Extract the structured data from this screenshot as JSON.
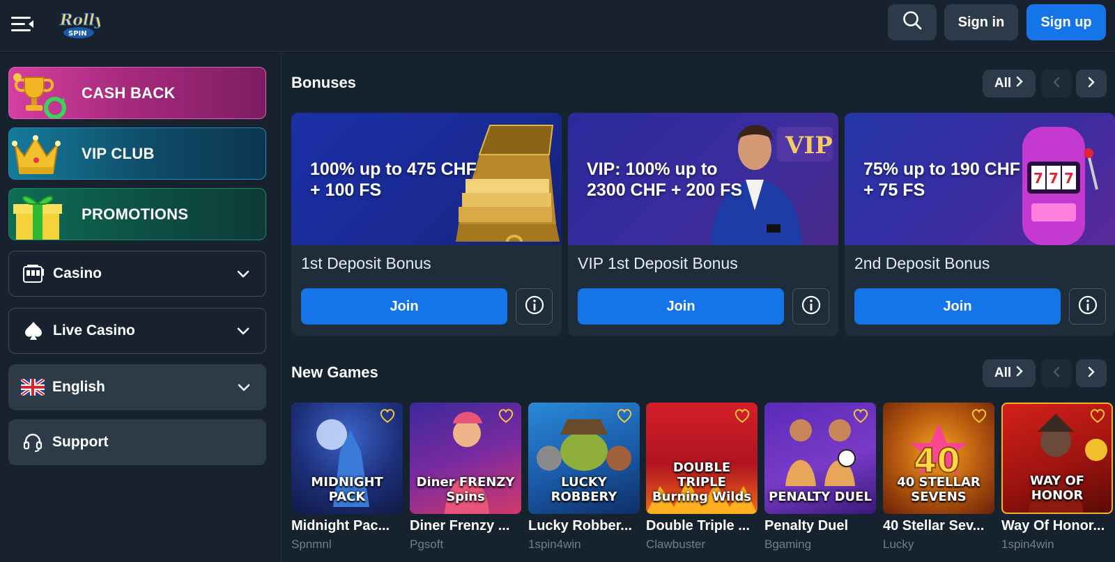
{
  "header": {
    "search_label": "",
    "signin_label": "Sign in",
    "signup_label": "Sign up"
  },
  "sidebar": {
    "promos": [
      {
        "label": "CASH BACK"
      },
      {
        "label": "VIP CLUB"
      },
      {
        "label": "PROMOTIONS"
      }
    ],
    "menu": [
      {
        "label": "Casino"
      },
      {
        "label": "Live Casino"
      },
      {
        "label": "English"
      },
      {
        "label": "Support"
      }
    ]
  },
  "bonuses": {
    "title": "Bonuses",
    "all_label": "All",
    "cards": [
      {
        "headline": "100% up to 475 CHF + 100 FS",
        "name": "1st Deposit Bonus",
        "join_label": "Join"
      },
      {
        "headline": "VIP: 100% up to 2300 CHF + 200 FS",
        "name": "VIP 1st Deposit Bonus",
        "join_label": "Join"
      },
      {
        "headline": "75% up to 190 CHF + 75 FS",
        "name": "2nd Deposit Bonus",
        "join_label": "Join"
      }
    ]
  },
  "new_games": {
    "title": "New Games",
    "all_label": "All",
    "games": [
      {
        "title": "Midnight Pac...",
        "provider": "Spnmnl",
        "logo": "MIDNIGHT PACK"
      },
      {
        "title": "Diner Frenzy ...",
        "provider": "Pgsoft",
        "logo": "Diner FRENZY Spins"
      },
      {
        "title": "Lucky Robber...",
        "provider": "1spin4win",
        "logo": "LUCKY ROBBERY"
      },
      {
        "title": "Double Triple ...",
        "provider": "Clawbuster",
        "logo": "DOUBLE TRIPLE Burning Wilds"
      },
      {
        "title": "Penalty Duel",
        "provider": "Bgaming",
        "logo": "PENALTY DUEL"
      },
      {
        "title": "40 Stellar Sev...",
        "provider": "Lucky",
        "logo": "40 STELLAR SEVENS"
      },
      {
        "title": "Way Of Honor...",
        "provider": "1spin4win",
        "logo": "WAY OF HONOR"
      }
    ]
  },
  "colors": {
    "bg": "#16222e",
    "accent": "#1474e8",
    "card": "#1f2c3a",
    "cashback": "#c2378f",
    "vip": "#157b9b",
    "promotions": "#0f6d55"
  }
}
